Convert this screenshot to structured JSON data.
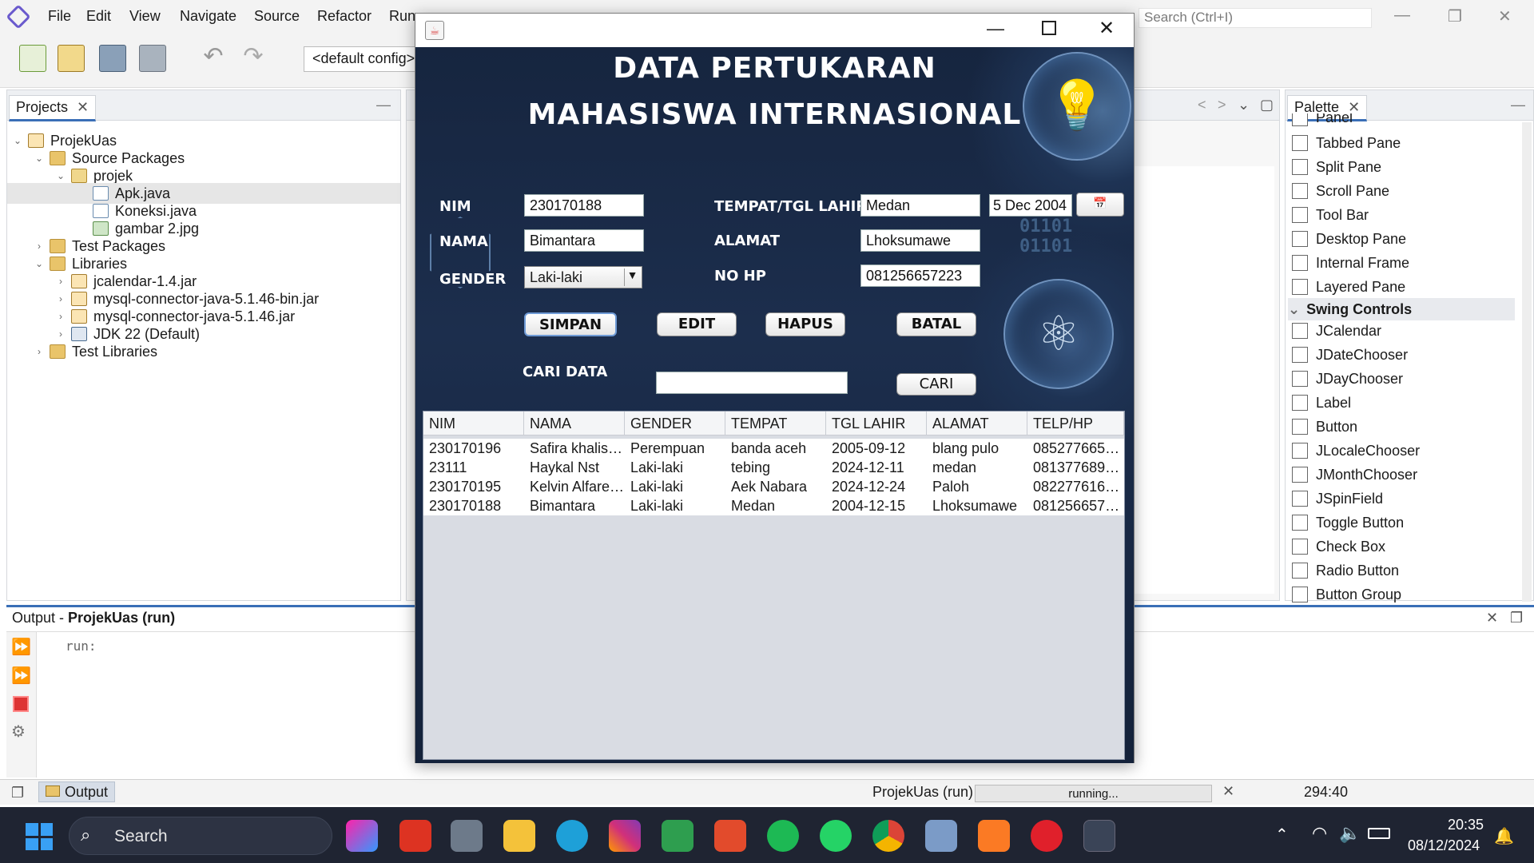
{
  "ide": {
    "menu": [
      "File",
      "Edit",
      "View",
      "Navigate",
      "Source",
      "Refactor",
      "Run"
    ],
    "config": "<default config>",
    "search_placeholder": "Search (Ctrl+I)"
  },
  "projects": {
    "tab": "Projects",
    "tree": [
      {
        "label": "ProjekUas",
        "icon": "project-icon",
        "indent": 0,
        "toggle": "v"
      },
      {
        "label": "Source Packages",
        "icon": "folder-icon",
        "indent": 1,
        "toggle": "v"
      },
      {
        "label": "projek",
        "icon": "package-icon",
        "indent": 2,
        "toggle": "v"
      },
      {
        "label": "Apk.java",
        "icon": "java-file-icon",
        "indent": 3,
        "toggle": "",
        "selected": true
      },
      {
        "label": "Koneksi.java",
        "icon": "java-file-icon",
        "indent": 3,
        "toggle": ""
      },
      {
        "label": "gambar 2.jpg",
        "icon": "image-file-icon",
        "indent": 3,
        "toggle": ""
      },
      {
        "label": "Test Packages",
        "icon": "folder-icon",
        "indent": 1,
        "toggle": ">"
      },
      {
        "label": "Libraries",
        "icon": "folder-icon",
        "indent": 1,
        "toggle": "v"
      },
      {
        "label": "jcalendar-1.4.jar",
        "icon": "jar-icon",
        "indent": 2,
        "toggle": ">"
      },
      {
        "label": "mysql-connector-java-5.1.46-bin.jar",
        "icon": "jar-icon",
        "indent": 2,
        "toggle": ">"
      },
      {
        "label": "mysql-connector-java-5.1.46.jar",
        "icon": "jar-icon",
        "indent": 2,
        "toggle": ">"
      },
      {
        "label": "JDK 22 (Default)",
        "icon": "jdk-icon",
        "indent": 2,
        "toggle": ">"
      },
      {
        "label": "Test Libraries",
        "icon": "folder-icon",
        "indent": 1,
        "toggle": ">"
      }
    ]
  },
  "palette": {
    "tab": "Palette",
    "partial_top": "Panel",
    "items_a": [
      "Tabbed Pane",
      "Split Pane",
      "Scroll Pane",
      "Tool Bar",
      "Desktop Pane",
      "Internal Frame",
      "Layered Pane"
    ],
    "section": "Swing Controls",
    "items_b": [
      "JCalendar",
      "JDateChooser",
      "JDayChooser",
      "Label",
      "Button",
      "JLocaleChooser",
      "JMonthChooser",
      "JSpinField",
      "Toggle Button",
      "Check Box",
      "Radio Button",
      "Button Group"
    ]
  },
  "app": {
    "title_line1": "DATA PERTUKARAN",
    "title_line2": "MAHASISWA INTERNASIONAL",
    "labels": {
      "nim": "NIM",
      "nama": "NAMA",
      "gender": "GENDER",
      "ttl": "TEMPAT/TGL LAHIR",
      "alamat": "ALAMAT",
      "nohp": "NO HP",
      "cari_data": "CARI DATA"
    },
    "values": {
      "nim": "230170188",
      "nama": "Bimantara",
      "gender": "Laki-laki",
      "tempat": "Medan",
      "tgl": "5 Dec 2004",
      "alamat": "Lhoksumawe",
      "nohp": "081256657223",
      "cari": ""
    },
    "buttons": {
      "simpan": "SIMPAN",
      "edit": "EDIT",
      "hapus": "HAPUS",
      "batal": "BATAL",
      "cari": "CARI"
    },
    "binary_text": "01101 01101",
    "table": {
      "headers": [
        "NIM",
        "NAMA",
        "GENDER",
        "TEMPAT",
        "TGL LAHIR",
        "ALAMAT",
        "TELP/HP"
      ],
      "rows": [
        [
          "230170196",
          "Safira khalis…",
          "Perempuan",
          "banda aceh",
          "2005-09-12",
          "blang pulo",
          "085277665…"
        ],
        [
          "23111",
          "Haykal Nst",
          "Laki-laki",
          "tebing",
          "2024-12-11",
          "medan",
          "081377689…"
        ],
        [
          "230170195",
          "Kelvin Alfare…",
          "Laki-laki",
          "Aek Nabara",
          "2024-12-24",
          "Paloh",
          "082277616…"
        ],
        [
          "230170188",
          "Bimantara",
          "Laki-laki",
          "Medan",
          "2004-12-15",
          "Lhoksumawe",
          "081256657…"
        ]
      ]
    }
  },
  "output": {
    "title_prefix": "Output - ",
    "title_project": "ProjekUas (run)",
    "text": "run:"
  },
  "status": {
    "tab": "Output",
    "project": "ProjekUas (run)",
    "progress": "running...",
    "position": "294:40"
  },
  "taskbar": {
    "search": "Search",
    "time": "20:35",
    "date": "08/12/2024"
  }
}
